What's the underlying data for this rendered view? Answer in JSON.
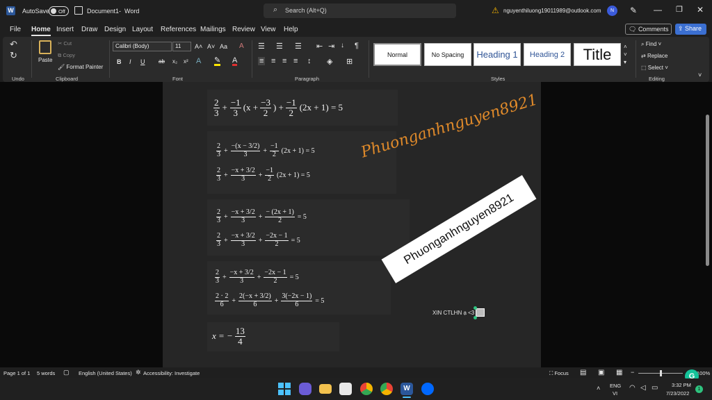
{
  "titlebar": {
    "autosave": "AutoSave",
    "toggle": "Off",
    "doc": "Document1",
    "sep": "-",
    "app": "Word",
    "search": "Search (Alt+Q)",
    "account": "nguyenthiluong19011989@outlook.com",
    "avatar": "N"
  },
  "menu": [
    "File",
    "Home",
    "Insert",
    "Draw",
    "Design",
    "Layout",
    "References",
    "Mailings",
    "Review",
    "View",
    "Help"
  ],
  "menu_right": {
    "comments": "Comments",
    "share": "Share"
  },
  "ribbon": {
    "undo_label": "Undo",
    "clipboard": {
      "paste": "Paste",
      "cut": "Cut",
      "copy": "Copy",
      "format_painter": "Format Painter",
      "label": "Clipboard"
    },
    "font": {
      "name": "Calibri (Body)",
      "size": "11",
      "grow": "A˄",
      "shrink": "A˅",
      "case": "Aa",
      "bold": "B",
      "italic": "I",
      "underline": "U",
      "strike": "ab",
      "sub": "x₂",
      "sup": "x²",
      "label": "Font"
    },
    "paragraph": {
      "label": "Paragraph"
    },
    "styles": {
      "items": [
        "Normal",
        "No Spacing",
        "Heading 1",
        "Heading 2",
        "Title"
      ],
      "label": "Styles"
    },
    "editing": {
      "find": "Find",
      "replace": "Replace",
      "select": "Select",
      "label": "Editing"
    }
  },
  "doc": {
    "eq1": {
      "f1n": "2",
      "f1d": "3",
      "op1": "+",
      "f2n": "−1",
      "f2d": "3",
      "p1": "(x +",
      "f3n": "−3",
      "f3d": "2",
      "p2": ") +",
      "f4n": "−1",
      "f4d": "2",
      "rest": "(2x + 1) = 5"
    },
    "eq2a": {
      "f1n": "2",
      "f1d": "3",
      "op": "+",
      "num": "−(x − 3/2)",
      "den": "3",
      "op2": "+",
      "f2n": "−1",
      "f2d": "2",
      "rest": "(2x + 1) = 5"
    },
    "eq2b": {
      "f1n": "2",
      "f1d": "3",
      "op": "+",
      "num": "−x + 3/2",
      "den": "3",
      "op2": "+",
      "f2n": "−1",
      "f2d": "2",
      "rest": "(2x + 1) = 5"
    },
    "eq3a": {
      "f1n": "2",
      "f1d": "3",
      "op": "+",
      "num": "−x + 3/2",
      "den": "3",
      "op2": "+",
      "f2n": "− (2x + 1)",
      "f2d": "2",
      "rest": "= 5"
    },
    "eq3b": {
      "f1n": "2",
      "f1d": "3",
      "op": "+",
      "num": "−x + 3/2",
      "den": "3",
      "op2": "+",
      "f2n": "−2x − 1",
      "f2d": "2",
      "rest": "= 5"
    },
    "eq4a": {
      "f1n": "2",
      "f1d": "3",
      "op": "+",
      "num": "−x + 3/2",
      "den": "3",
      "op2": "+",
      "f2n": "−2x − 1",
      "f2d": "2",
      "rest": "= 5"
    },
    "eq4b": {
      "f1n": "2 · 2",
      "f1d": "6",
      "op": "+",
      "num": "2(−x + 3/2)",
      "den": "6",
      "op2": "+",
      "f2n": "3(−2x − 1)",
      "f2d": "6",
      "rest": "= 5"
    },
    "eq5": {
      "lhs": "x = −",
      "n": "13",
      "d": "4"
    },
    "handwriting": "Phuonganhnguyen8921",
    "banner": "Phuonganhnguyen8921",
    "note": "XIN CTLHN ạ <3"
  },
  "status": {
    "page": "Page 1 of 1",
    "words": "5 words",
    "lang": "English (United States)",
    "access": "Accessibility: Investigate",
    "focus": "Focus",
    "zoom": "100%"
  },
  "taskbar": {
    "lang1": "ENG",
    "lang2": "VI",
    "time": "3:32 PM",
    "date": "7/23/2022",
    "badge": "1"
  }
}
